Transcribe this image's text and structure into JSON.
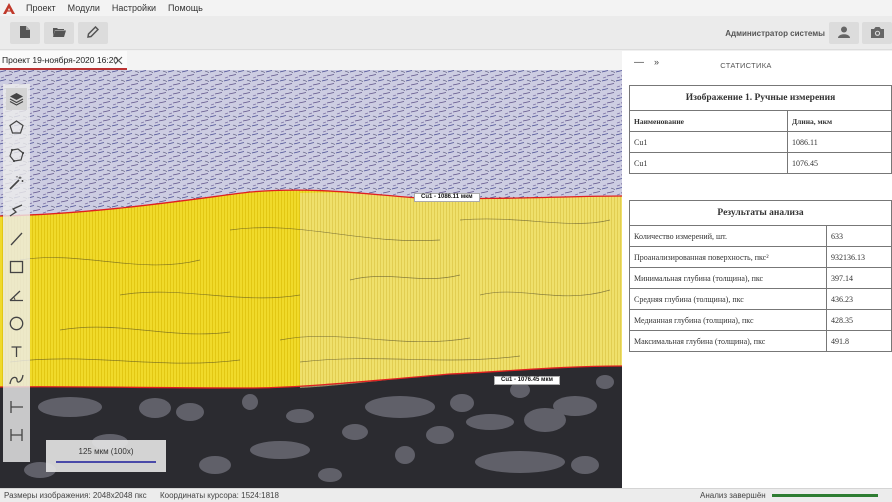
{
  "menu": {
    "items": [
      "Проект",
      "Модули",
      "Настройки",
      "Помощь"
    ]
  },
  "toolbar": {
    "user_label": "Администратор системы"
  },
  "tab": {
    "label": "Проект 19-ноября-2020 16:20"
  },
  "canvas": {
    "measurement_labels": [
      "Cu1 - 1086.11 мкм",
      "Cu1 - 1076.45 мкм"
    ],
    "scale_label": "125 мкм (100x)"
  },
  "panel": {
    "collapse_glyph": "—",
    "expand_glyph": "»",
    "title": "СТАТИСТИКА",
    "table1": {
      "caption": "Изображение 1. Ручные измерения",
      "headers": [
        "Наименование",
        "Длина, мкм"
      ],
      "rows": [
        [
          "Cu1",
          "1086.11"
        ],
        [
          "Cu1",
          "1076.45"
        ]
      ]
    },
    "table2": {
      "caption": "Результаты анализа",
      "rows": [
        [
          "Количество измерений, шт.",
          "633"
        ],
        [
          "Проанализированная поверхность, пкс²",
          "932136.13"
        ],
        [
          "Минимальная глубина (толщина), пкс",
          "397.14"
        ],
        [
          "Средняя глубина (толщина), пкс",
          "436.23"
        ],
        [
          "Медианная глубина (толщина), пкс",
          "428.35"
        ],
        [
          "Максимальная глубина (толщина), пкс",
          "491.8"
        ]
      ]
    }
  },
  "status": {
    "image_size": "Размеры изображения: 2048x2048 пкс",
    "cursor": "Координаты курсора: 1524:1818",
    "analysis": "Анализ завершён",
    "progress": 1.0
  },
  "colors": {
    "accent": "#c0392b",
    "overlay": "#f2dc00",
    "boundary": "#e02020",
    "progress": "#2e7d32"
  }
}
